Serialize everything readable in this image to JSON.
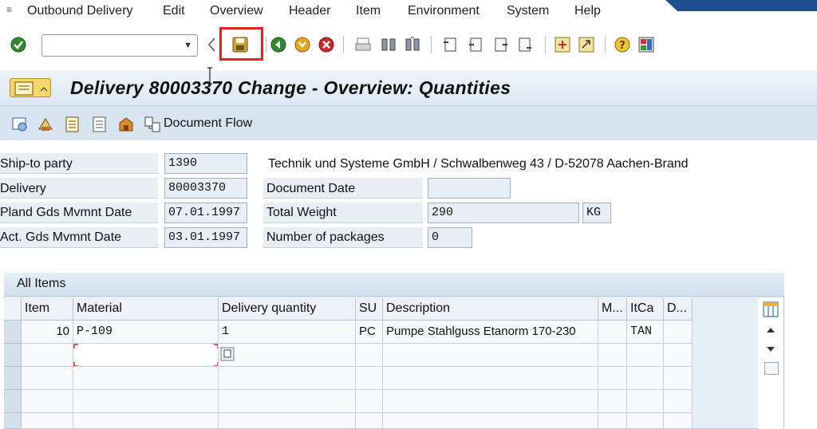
{
  "menu": {
    "items": [
      "Outbound Delivery",
      "Edit",
      "Overview",
      "Header",
      "Item",
      "Environment",
      "System",
      "Help"
    ]
  },
  "toolbar": {
    "command_field_value": "",
    "icons": [
      "enter-icon",
      "save-icon",
      "back-icon",
      "exit-icon",
      "cancel-icon",
      "print-icon",
      "find-icon",
      "find-next-icon",
      "first-page-icon",
      "previous-page-icon",
      "next-page-icon",
      "last-page-icon",
      "create-session-icon",
      "shortcut-icon",
      "help-icon",
      "layout-icon"
    ]
  },
  "title": {
    "text": "Delivery 80003370 Change - Overview: Quantities"
  },
  "app_toolbar": {
    "document_flow_label": "Document Flow"
  },
  "header_fields": {
    "ship_to_party_label": "Ship-to party",
    "ship_to_party_value": "1390",
    "ship_to_party_address": "Technik und Systeme GmbH / Schwalbenweg 43 / D-52078 Aachen-Brand",
    "delivery_label": "Delivery",
    "delivery_value": "80003370",
    "document_date_label": "Document Date",
    "document_date_value": "",
    "planned_gm_label": "Pland Gds Mvmnt Date",
    "planned_gm_value": "07.01.1997",
    "total_weight_label": "Total Weight",
    "total_weight_value": "290",
    "total_weight_unit": "KG",
    "actual_gm_label": "Act. Gds Mvmnt Date",
    "actual_gm_value": "03.01.1997",
    "packages_label": "Number of packages",
    "packages_value": "0"
  },
  "items_table": {
    "title": "All Items",
    "columns": [
      "Item",
      "Material",
      "Delivery quantity",
      "SU",
      "Description",
      "M...",
      "ItCa",
      "D..."
    ],
    "rows": [
      [
        "10",
        "P-109",
        "1",
        "PC",
        "Pumpe Stahlguss Etanorm 170-230",
        "",
        "TAN",
        ""
      ]
    ]
  },
  "colors": {
    "highlight": "#e32222",
    "title_bar": "#dde8f3",
    "app_toolbar": "#d8e5f1"
  }
}
